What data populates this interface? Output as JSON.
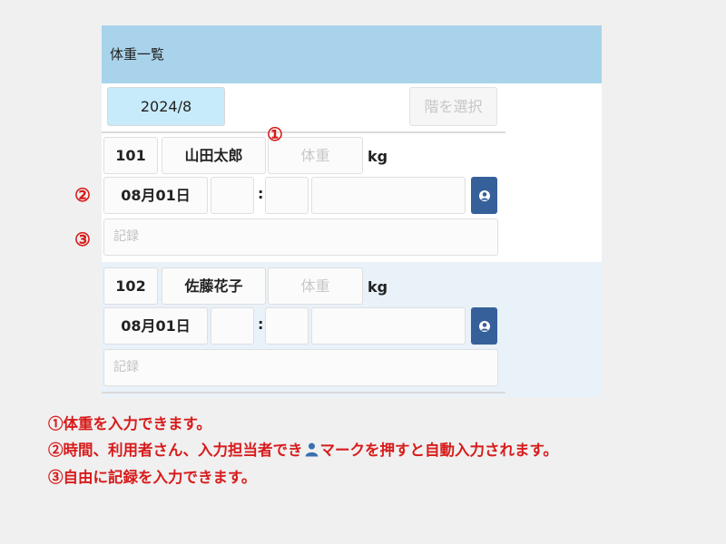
{
  "header": {
    "title": "体重一覧"
  },
  "toolbar": {
    "month_label": "2024/8",
    "floor_select_label": "階を選択"
  },
  "records": [
    {
      "room": "101",
      "name": "山田太郎",
      "weight_placeholder": "体重",
      "unit": "kg",
      "date": "08月01日",
      "colon": ":",
      "memo_placeholder": "記録"
    },
    {
      "room": "102",
      "name": "佐藤花子",
      "weight_placeholder": "体重",
      "unit": "kg",
      "date": "08月01日",
      "colon": ":",
      "memo_placeholder": "記録"
    }
  ],
  "markers": [
    "①",
    "②",
    "③"
  ],
  "notes": [
    "①体重を入力できます。",
    "②時間、利用者さん、入力担当者でき",
    "マークを押すと自動入力されます。",
    "③自由に記録を入力できます。"
  ],
  "icons": {
    "user_button": "user-icon",
    "note_person": "person-icon"
  },
  "colors": {
    "header": "#a9d3ea",
    "month_button": "#c7ebfb",
    "user_button": "#36609a",
    "note_text": "#d81b1b",
    "alt_row": "#e9f1f9"
  }
}
